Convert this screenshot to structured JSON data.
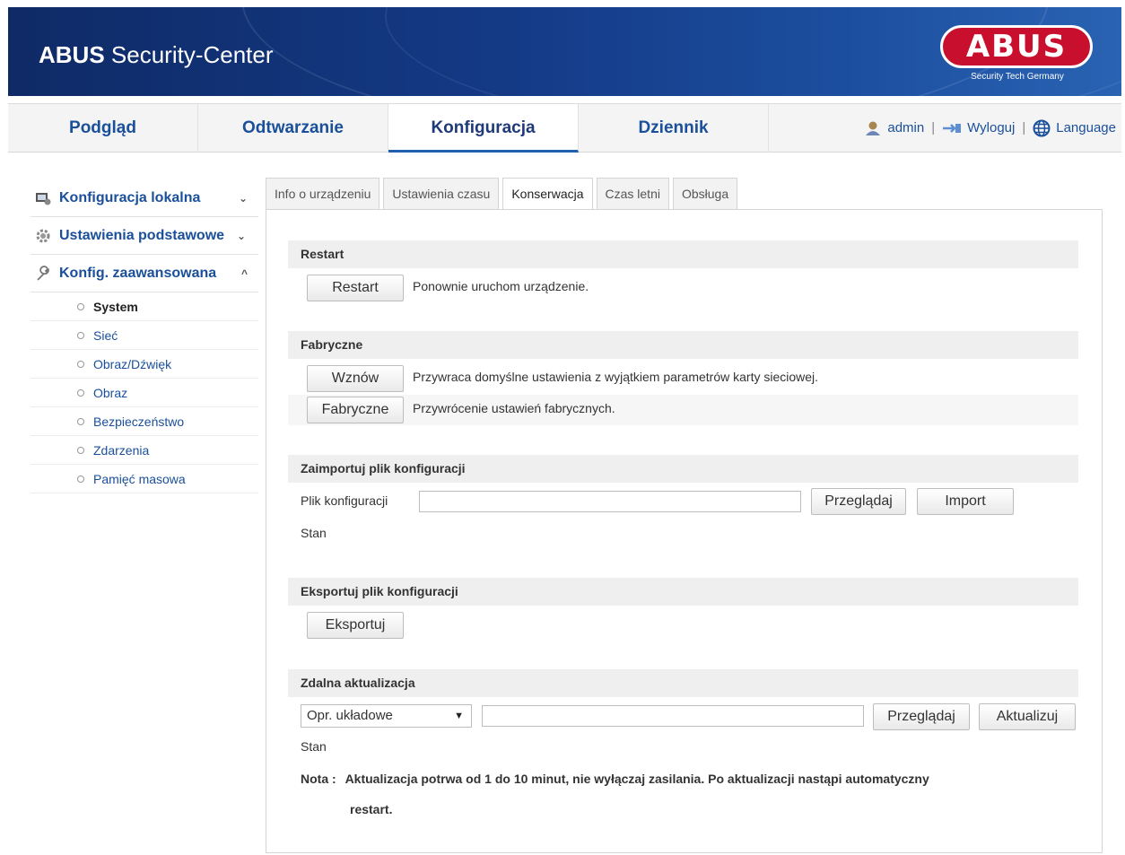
{
  "header": {
    "brand_bold": "ABUS",
    "brand_rest": " Security-Center",
    "logo_text": "ABUS",
    "logo_sub": "Security Tech Germany"
  },
  "nav": {
    "tabs": [
      {
        "label": "Podgląd"
      },
      {
        "label": "Odtwarzanie"
      },
      {
        "label": "Konfiguracja",
        "active": true
      },
      {
        "label": "Dziennik"
      }
    ],
    "user": "admin",
    "logout": "Wyloguj",
    "language": "Language",
    "separator": "|"
  },
  "sidebar": {
    "sections": [
      {
        "label": "Konfiguracja lokalna",
        "icon": "local-config-icon",
        "chevron": "⌄"
      },
      {
        "label": "Ustawienia podstawowe",
        "icon": "gear-icon",
        "chevron": "⌄"
      },
      {
        "label": "Konfig. zaawansowana",
        "icon": "wrench-icon",
        "chevron": "^"
      }
    ],
    "items": [
      {
        "label": "System",
        "active": true
      },
      {
        "label": "Sieć"
      },
      {
        "label": "Obraz/Dźwięk"
      },
      {
        "label": "Obraz"
      },
      {
        "label": "Bezpieczeństwo"
      },
      {
        "label": "Zdarzenia"
      },
      {
        "label": "Pamięć masowa"
      }
    ]
  },
  "tabs": [
    {
      "label": "Info o urządzeniu"
    },
    {
      "label": "Ustawienia czasu"
    },
    {
      "label": "Konserwacja",
      "active": true
    },
    {
      "label": "Czas letni"
    },
    {
      "label": "Obsługa"
    }
  ],
  "restart": {
    "title": "Restart",
    "button": "Restart",
    "desc": "Ponownie uruchom urządzenie."
  },
  "factory": {
    "title": "Fabryczne",
    "restore_button": "Wznów",
    "restore_desc": "Przywraca domyślne ustawienia z wyjątkiem parametrów karty sieciowej.",
    "factory_button": "Fabryczne",
    "factory_desc": "Przywrócenie ustawień fabrycznych."
  },
  "import": {
    "title": "Zaimportuj plik konfiguracji",
    "file_label": "Plik konfiguracji",
    "file_value": "",
    "browse_button": "Przeglądaj",
    "import_button": "Import",
    "status_label": "Stan"
  },
  "export": {
    "title": "Eksportuj plik konfiguracji",
    "button": "Eksportuj"
  },
  "upgrade": {
    "title": "Zdalna aktualizacja",
    "select_value": "Opr. układowe",
    "file_value": "",
    "browse_button": "Przeglądaj",
    "update_button": "Aktualizuj",
    "status_label": "Stan",
    "note_label": "Nota :",
    "note_text": "Aktualizacja potrwa od 1 do 10 minut, nie wyłączaj zasilania. Po aktualizacji nastąpi automatyczny",
    "note_text2": "restart."
  },
  "colors": {
    "banner": "#143a86",
    "nav_text": "#1a4f9a",
    "logo_red": "#c8102e"
  }
}
